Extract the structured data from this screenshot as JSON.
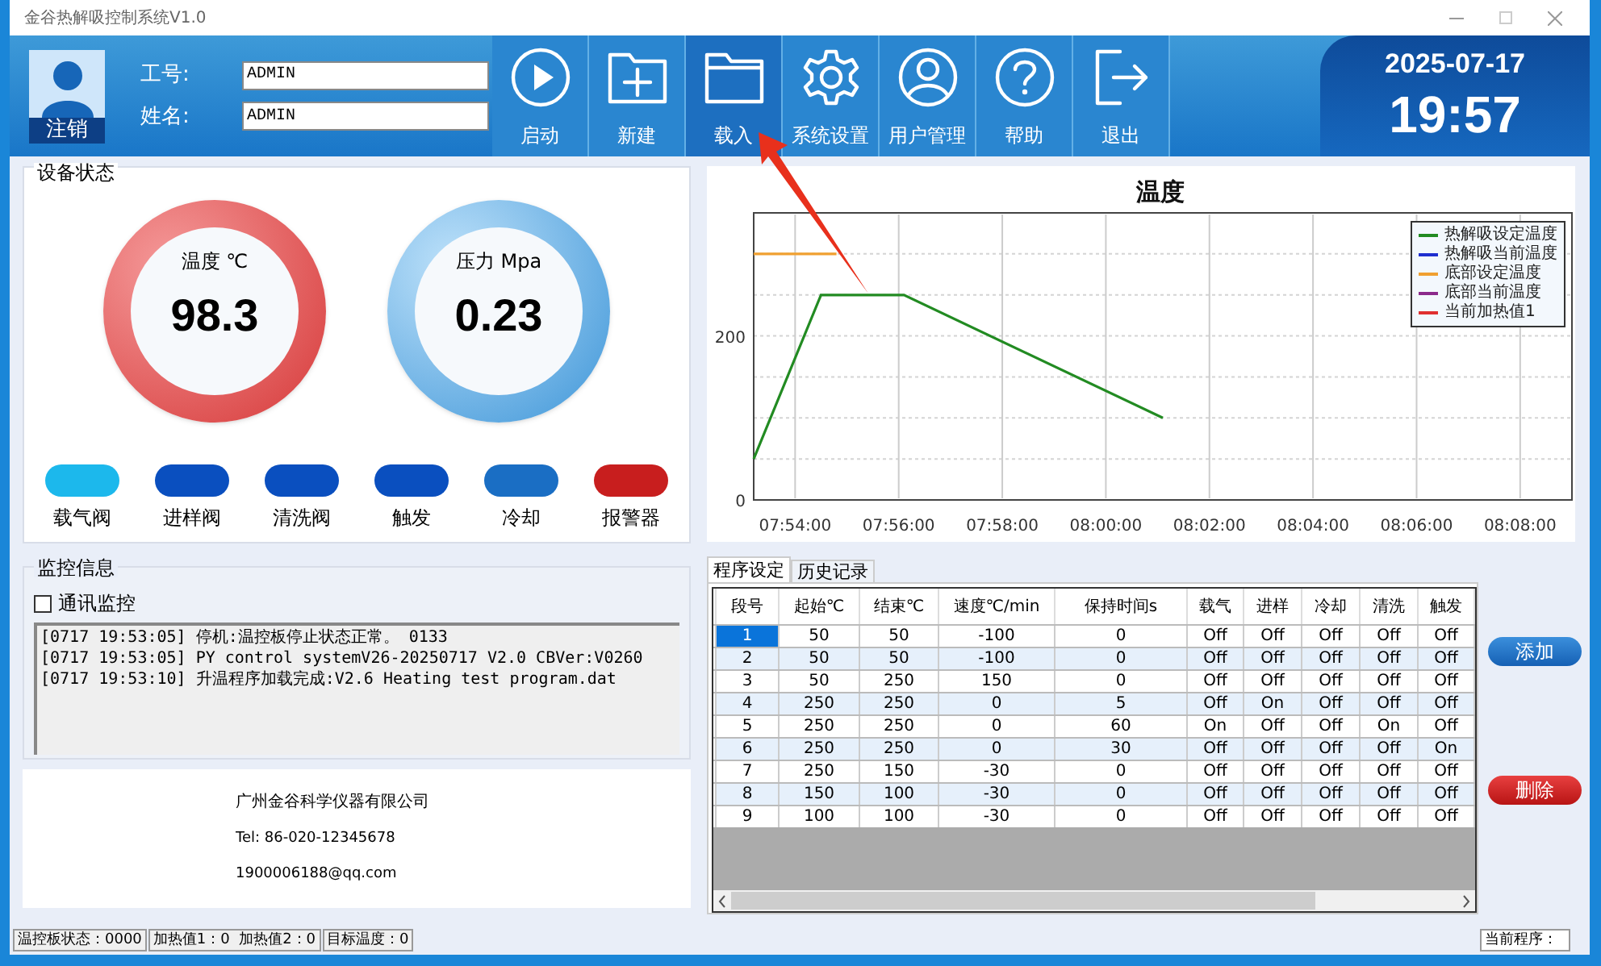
{
  "window": {
    "title": "金谷热解吸控制系统V1.0"
  },
  "user": {
    "logout": "注销",
    "fields": [
      {
        "label": "工号:",
        "value": "ADMIN"
      },
      {
        "label": "姓名:",
        "value": "ADMIN"
      }
    ]
  },
  "toolbar": [
    {
      "kind": "play",
      "label": "启动",
      "selected": false
    },
    {
      "kind": "new",
      "label": "新建",
      "selected": false
    },
    {
      "kind": "folder",
      "label": "载入",
      "selected": true
    },
    {
      "kind": "gear",
      "label": "系统设置",
      "selected": false
    },
    {
      "kind": "user",
      "label": "用户管理",
      "selected": false
    },
    {
      "kind": "help",
      "label": "帮助",
      "selected": false
    },
    {
      "kind": "exit",
      "label": "退出",
      "selected": false
    }
  ],
  "clock": {
    "date": "2025-07-17",
    "time": "19:57"
  },
  "device_status": {
    "title": "设备状态",
    "gauges": [
      {
        "kind": "temperature",
        "label": "温度 ℃",
        "value": "98.3"
      },
      {
        "kind": "pressure",
        "label": "压力 Mpa",
        "value": "0.23"
      }
    ],
    "indicators": [
      {
        "label": "载气阀",
        "color": "#1cb8ec"
      },
      {
        "label": "进样阀",
        "color": "#0a4fbf"
      },
      {
        "label": "清洗阀",
        "color": "#0a4fbf"
      },
      {
        "label": "触发",
        "color": "#0a4fbf"
      },
      {
        "label": "冷却",
        "color": "#1a6ec4"
      },
      {
        "label": "报警器",
        "color": "#c81e1e"
      }
    ]
  },
  "monitor": {
    "title": "监控信息",
    "checkbox": {
      "label": "通讯监控",
      "checked": false
    },
    "log": [
      "[0717 19:53:05] 停机:温控板停止状态正常。 0133",
      "[0717 19:53:05] PY control systemV26-20250717 V2.0 CBVer:V0260",
      "[0717 19:53:10] 升温程序加载完成:V2.6 Heating test program.dat"
    ]
  },
  "company": {
    "name": "广州金谷科学仪器有限公司",
    "tel": "Tel: 86-020-12345678",
    "email": "1900006188@qq.com"
  },
  "chart": {
    "chart_data": {
      "type": "line",
      "title": "温度",
      "x": [
        28392,
        28470,
        28488,
        28566,
        28866
      ],
      "xlim": [
        28392,
        29340
      ],
      "ylim": [
        0,
        350
      ],
      "xticks": [
        {
          "value": 28440,
          "label": "07:54:00"
        },
        {
          "value": 28560,
          "label": "07:56:00"
        },
        {
          "value": 28680,
          "label": "07:58:00"
        },
        {
          "value": 28800,
          "label": "08:00:00"
        },
        {
          "value": 28920,
          "label": "08:02:00"
        },
        {
          "value": 29040,
          "label": "08:04:00"
        },
        {
          "value": 29160,
          "label": "08:06:00"
        },
        {
          "value": 29280,
          "label": "08:08:00"
        }
      ],
      "yticks": [
        0,
        200
      ],
      "grid": true,
      "legend": "upper right",
      "series": [
        {
          "name": "热解吸设定温度",
          "color": "#228b22",
          "values": [
            50,
            250,
            250,
            250,
            100
          ]
        },
        {
          "name": "热解吸当前温度",
          "color": "#1f2fd0",
          "values": [
            null,
            null,
            null,
            null,
            null
          ]
        },
        {
          "name": "底部设定温度",
          "color": "#f0a030",
          "values": [
            300,
            300,
            300,
            null,
            null
          ]
        },
        {
          "name": "底部当前温度",
          "color": "#8b2a8b",
          "values": [
            null,
            null,
            null,
            null,
            null
          ]
        },
        {
          "name": "当前加热值1",
          "color": "#e03030",
          "values": [
            null,
            null,
            null,
            null,
            null
          ]
        }
      ]
    }
  },
  "tabs": [
    {
      "label": "程序设定",
      "selected": true
    },
    {
      "label": "历史记录",
      "selected": false
    }
  ],
  "table": {
    "columns": [
      "段号",
      "起始℃",
      "结束℃",
      "速度℃/min",
      "保持时间s",
      "载气",
      "进样",
      "冷却",
      "清洗",
      "触发"
    ],
    "rows": [
      {
        "selected": true,
        "cells": [
          "1",
          "50",
          "50",
          "-100",
          "0",
          "Off",
          "Off",
          "Off",
          "Off",
          "Off"
        ]
      },
      {
        "selected": false,
        "cells": [
          "2",
          "50",
          "50",
          "-100",
          "0",
          "Off",
          "Off",
          "Off",
          "Off",
          "Off"
        ]
      },
      {
        "selected": false,
        "cells": [
          "3",
          "50",
          "250",
          "150",
          "0",
          "Off",
          "Off",
          "Off",
          "Off",
          "Off"
        ]
      },
      {
        "selected": false,
        "cells": [
          "4",
          "250",
          "250",
          "0",
          "5",
          "Off",
          "On",
          "Off",
          "Off",
          "Off"
        ]
      },
      {
        "selected": false,
        "cells": [
          "5",
          "250",
          "250",
          "0",
          "60",
          "On",
          "Off",
          "Off",
          "On",
          "Off"
        ]
      },
      {
        "selected": false,
        "cells": [
          "6",
          "250",
          "250",
          "0",
          "30",
          "Off",
          "Off",
          "Off",
          "Off",
          "On"
        ]
      },
      {
        "selected": false,
        "cells": [
          "7",
          "250",
          "150",
          "-30",
          "0",
          "Off",
          "Off",
          "Off",
          "Off",
          "Off"
        ]
      },
      {
        "selected": false,
        "cells": [
          "8",
          "150",
          "100",
          "-30",
          "0",
          "Off",
          "Off",
          "Off",
          "Off",
          "Off"
        ]
      },
      {
        "selected": false,
        "cells": [
          "9",
          "100",
          "100",
          "-30",
          "0",
          "Off",
          "Off",
          "Off",
          "Off",
          "Off"
        ]
      }
    ]
  },
  "actions": [
    {
      "kind": "add",
      "label": "添加"
    },
    {
      "kind": "delete",
      "label": "删除"
    }
  ],
  "status_bar": {
    "segments": [
      "温控板状态：0000",
      "加热值1：0  加热值2：0",
      "目标温度：0"
    ],
    "program": "当前程序："
  }
}
